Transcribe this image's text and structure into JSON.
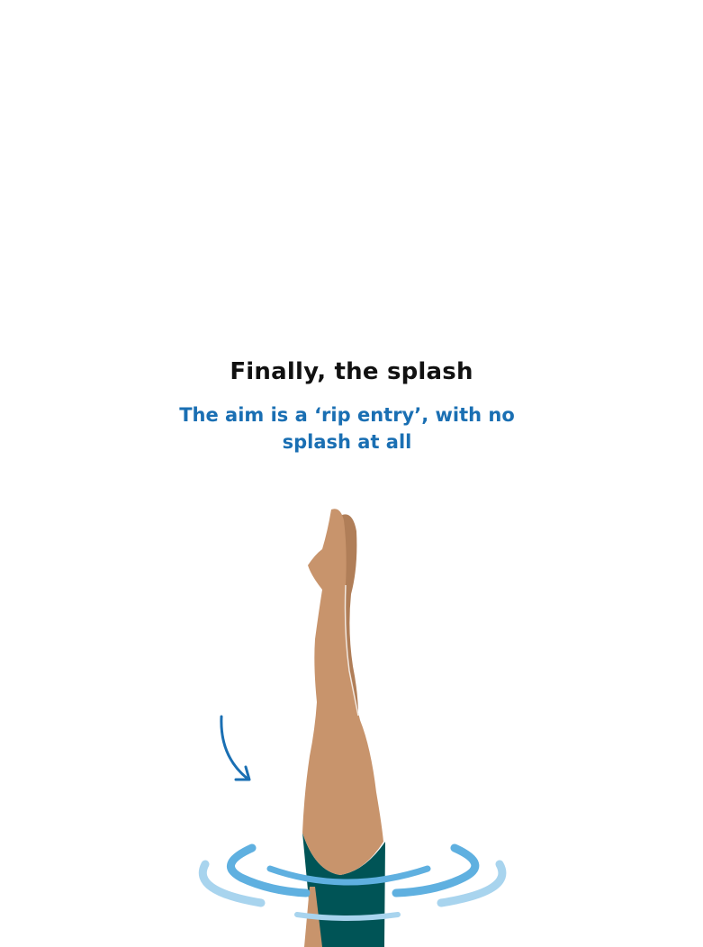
{
  "heading": {
    "title": "Finally, the splash",
    "subtitle": "The aim is a ‘rip entry’, with no splash at all"
  },
  "illustration": {
    "icon": "diver-legs-entering-water",
    "arrow_icon": "curved-arrow-down-icon",
    "ripple_icon": "water-ripple-icon"
  },
  "colors": {
    "title": "#111111",
    "subtitle": "#1a6fb3",
    "skin": "#c8946c",
    "skin_shadow": "#b07e58",
    "swimsuit": "#005456",
    "ripple_dark": "#5fb0e0",
    "ripple_light": "#a8d4ee",
    "arrow": "#1a6fb3"
  }
}
